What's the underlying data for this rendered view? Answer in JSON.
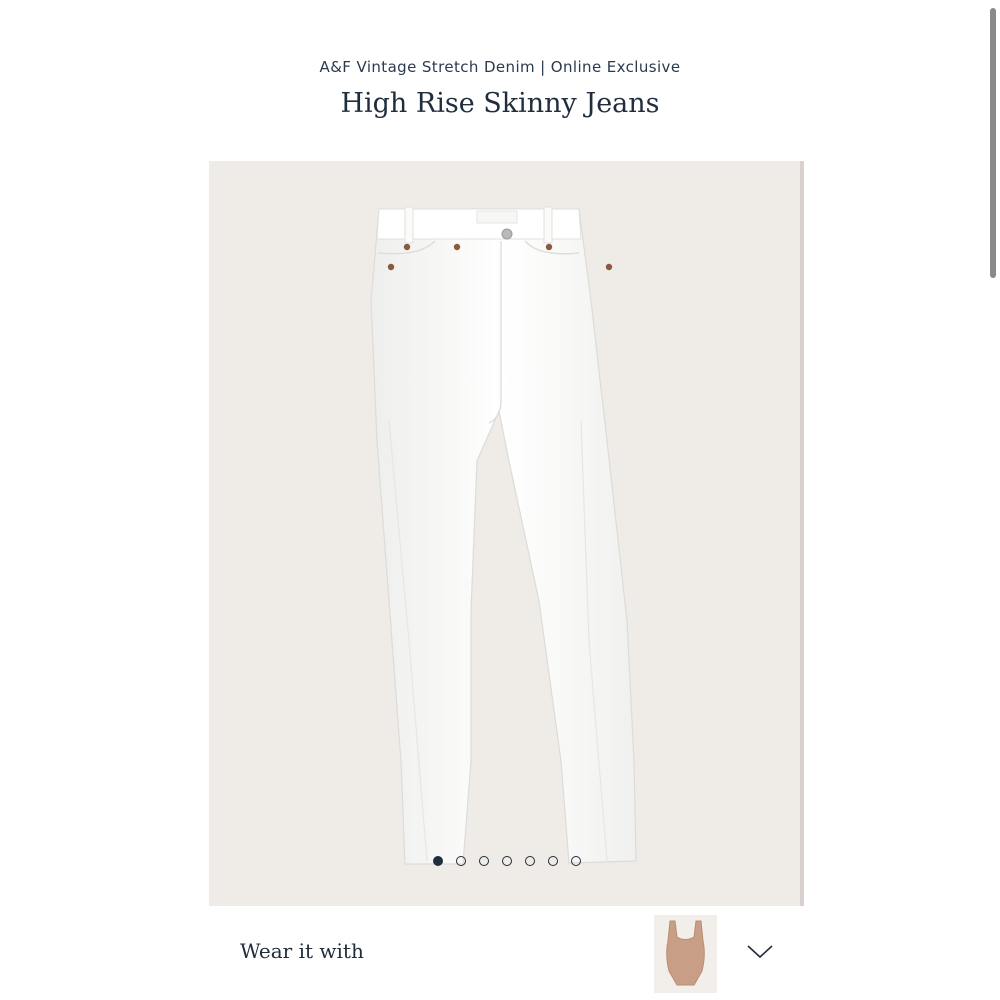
{
  "header": {
    "brand_line": "A&F Vintage Stretch Denim | Online Exclusive",
    "title": "High Rise Skinny Jeans"
  },
  "gallery": {
    "image_alt": "white-skinny-jeans-photo",
    "total_images": 7,
    "active_index": 0,
    "background_color": "#efebe6"
  },
  "wear_it_with": {
    "label": "Wear it with",
    "thumbnail_item": "bodysuit",
    "thumbnail_color": "#c89e86",
    "toggle_icon": "chevron-down-icon"
  }
}
